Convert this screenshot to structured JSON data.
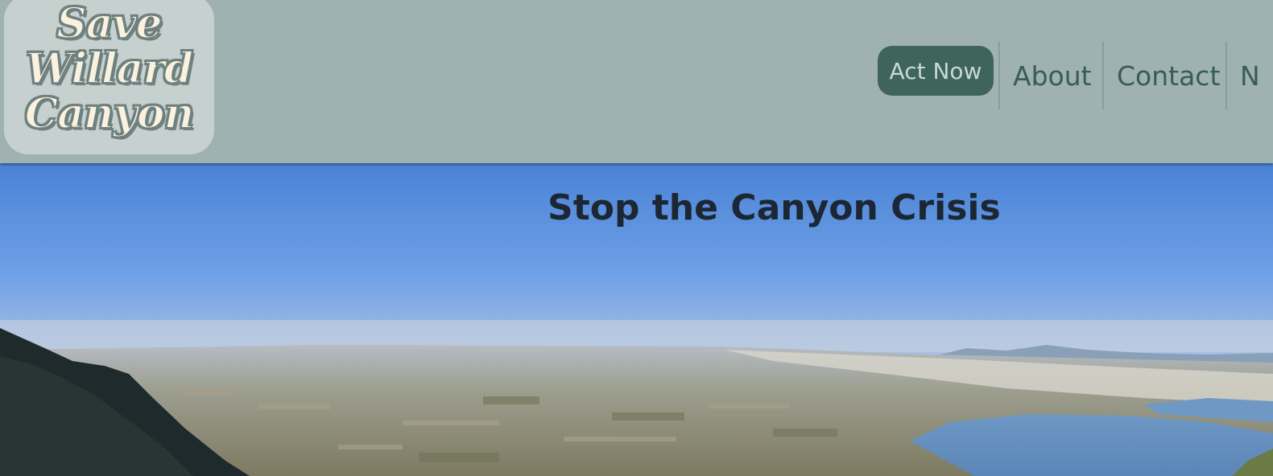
{
  "header": {
    "logo": {
      "lines": [
        "Save",
        "Willard",
        "Canyon"
      ]
    },
    "nav": {
      "cta_label": "Act Now",
      "links": [
        "About",
        "Contact",
        "N"
      ]
    }
  },
  "hero": {
    "title": "Stop the Canyon Crisis"
  },
  "colors": {
    "header_bg": "#a0b1b2",
    "cta_bg": "#3f645c",
    "nav_text": "#385c56",
    "logo_fill": "#fbf1df"
  }
}
